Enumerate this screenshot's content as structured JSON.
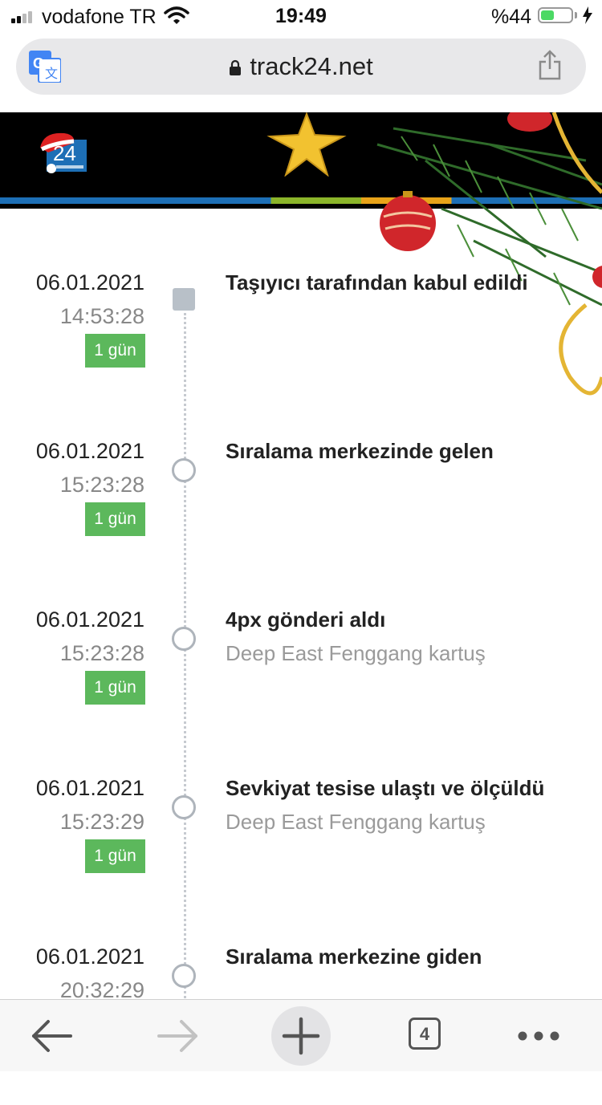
{
  "status_bar": {
    "carrier": "vodafone TR",
    "time": "19:49",
    "battery_percent": "%44",
    "battery_level": 0.44
  },
  "url_bar": {
    "url": "track24.net"
  },
  "header": {
    "logo_text": "24"
  },
  "events": [
    {
      "date": "06.01.2021",
      "time": "14:53:28",
      "badge": "1 gün",
      "title": "Taşıyıcı tarafından kabul edildi",
      "subtitle": ""
    },
    {
      "date": "06.01.2021",
      "time": "15:23:28",
      "badge": "1 gün",
      "title": "Sıralama merkezinde gelen",
      "subtitle": ""
    },
    {
      "date": "06.01.2021",
      "time": "15:23:28",
      "badge": "1 gün",
      "title": "4px gönderi aldı",
      "subtitle": "Deep East Fenggang kartuş"
    },
    {
      "date": "06.01.2021",
      "time": "15:23:29",
      "badge": "1 gün",
      "title": "Sevkiyat tesise ulaştı ve ölçüldü",
      "subtitle": "Deep East Fenggang kartuş"
    },
    {
      "date": "06.01.2021",
      "time": "20:32:29",
      "badge": "",
      "title": "Sıralama merkezine giden",
      "subtitle": ""
    }
  ],
  "toolbar": {
    "tab_count": "4"
  },
  "colors": {
    "badge_green": "#5cb85c",
    "banner_bg": "#000000",
    "accent_blue": "#1d6fb6"
  }
}
